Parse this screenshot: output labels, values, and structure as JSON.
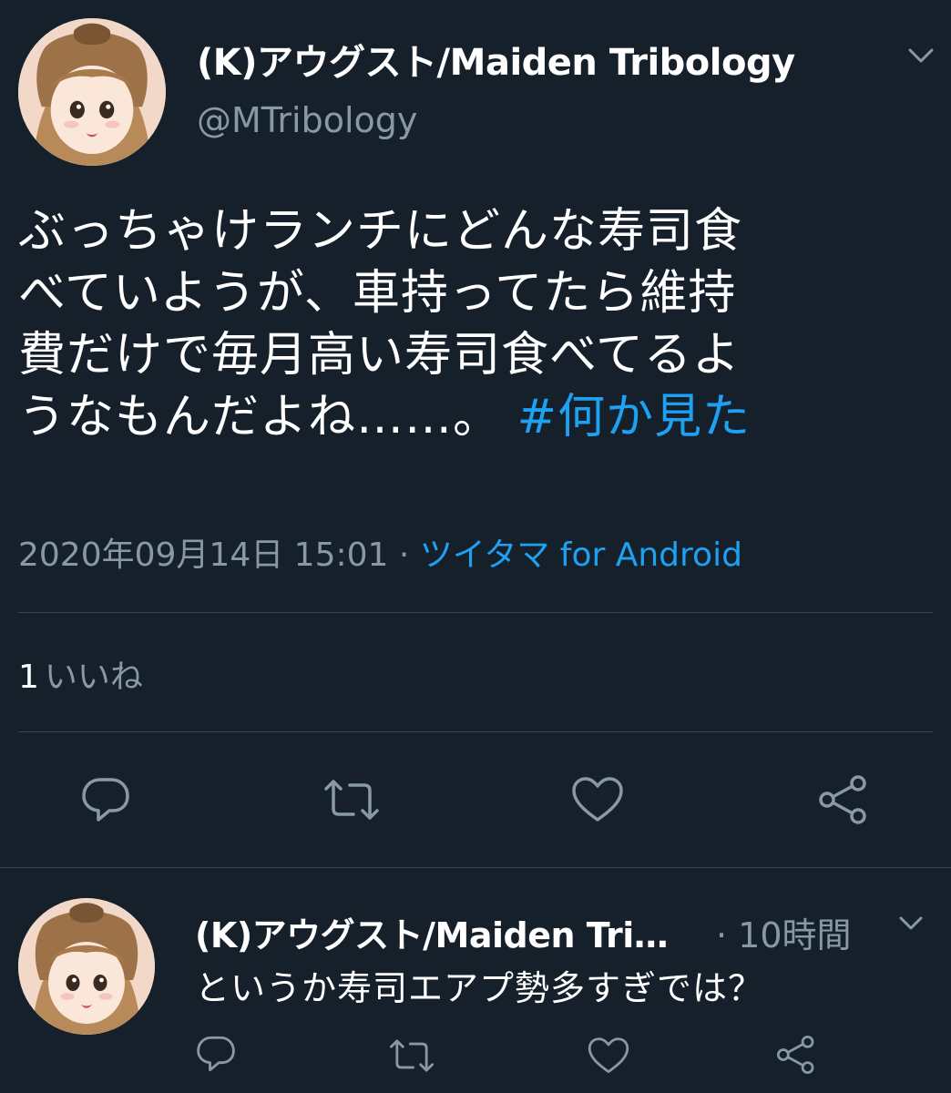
{
  "tweet": {
    "author_name": "(K)アウグスト/Maiden Tribology",
    "handle": "@MTribology",
    "body_lines": [
      "ぶっちゃけランチにどんな寿司食",
      "べていようが、車持ってたら維持",
      "費だけで毎月高い寿司食べてるよ",
      "うなもんだよね……。"
    ],
    "hashtag": "#何か見た",
    "timestamp": "2020年09月14日 15:01",
    "separator": "·",
    "client": "ツイタマ for Android",
    "likes_count": "1",
    "likes_label": "いいね"
  },
  "reply": {
    "author_name": "(K)アウグスト/Maiden Tri…",
    "time": "· 10時間",
    "text": "というか寿司エアプ勢多すぎでは？"
  },
  "icons": {
    "more": "chevron-down-icon",
    "reply": "reply-icon",
    "retweet": "retweet-icon",
    "like": "heart-icon",
    "share": "share-icon"
  },
  "colors": {
    "background": "#15202b",
    "text": "#ffffff",
    "secondary": "#8899a6",
    "accent": "#1da1f2",
    "divider": "#38444d"
  }
}
